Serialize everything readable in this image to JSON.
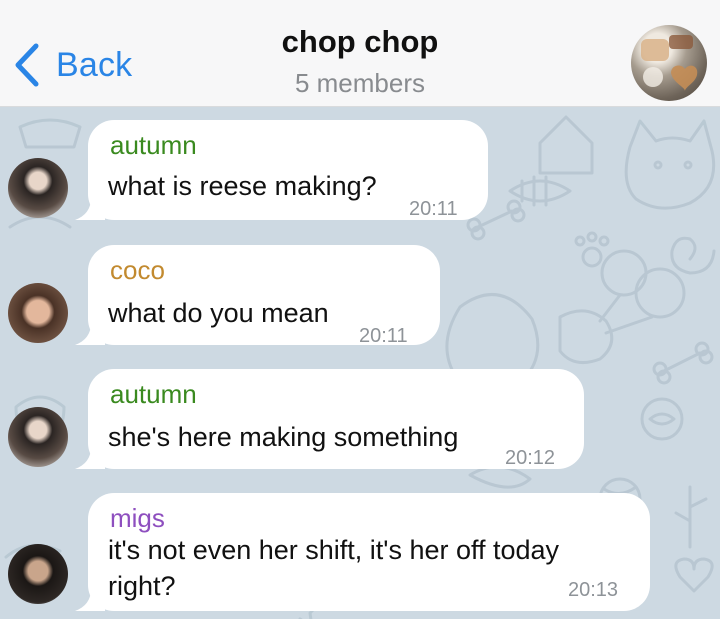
{
  "header": {
    "back_label": "Back",
    "title": "chop chop",
    "subtitle": "5 members"
  },
  "colors": {
    "accent": "#2a85e6",
    "autumn": "#3a8a1f",
    "coco": "#c28a2f",
    "migs": "#8e4fbf",
    "chat_background": "#cdd9e2",
    "bubble": "#ffffff"
  },
  "icons": {
    "back": "chevron-left-icon",
    "group_avatar": "group-avatar-photo"
  },
  "messages": [
    {
      "sender": "autumn",
      "text": "what is reese making?",
      "time": "20:11"
    },
    {
      "sender": "coco",
      "text": "what do you mean",
      "time": "20:11"
    },
    {
      "sender": "autumn",
      "text": "she's here making something",
      "time": "20:12"
    },
    {
      "sender": "migs",
      "text_lines": [
        "it's not even her shift, it's her off today",
        "right?"
      ],
      "time": "20:13"
    }
  ]
}
